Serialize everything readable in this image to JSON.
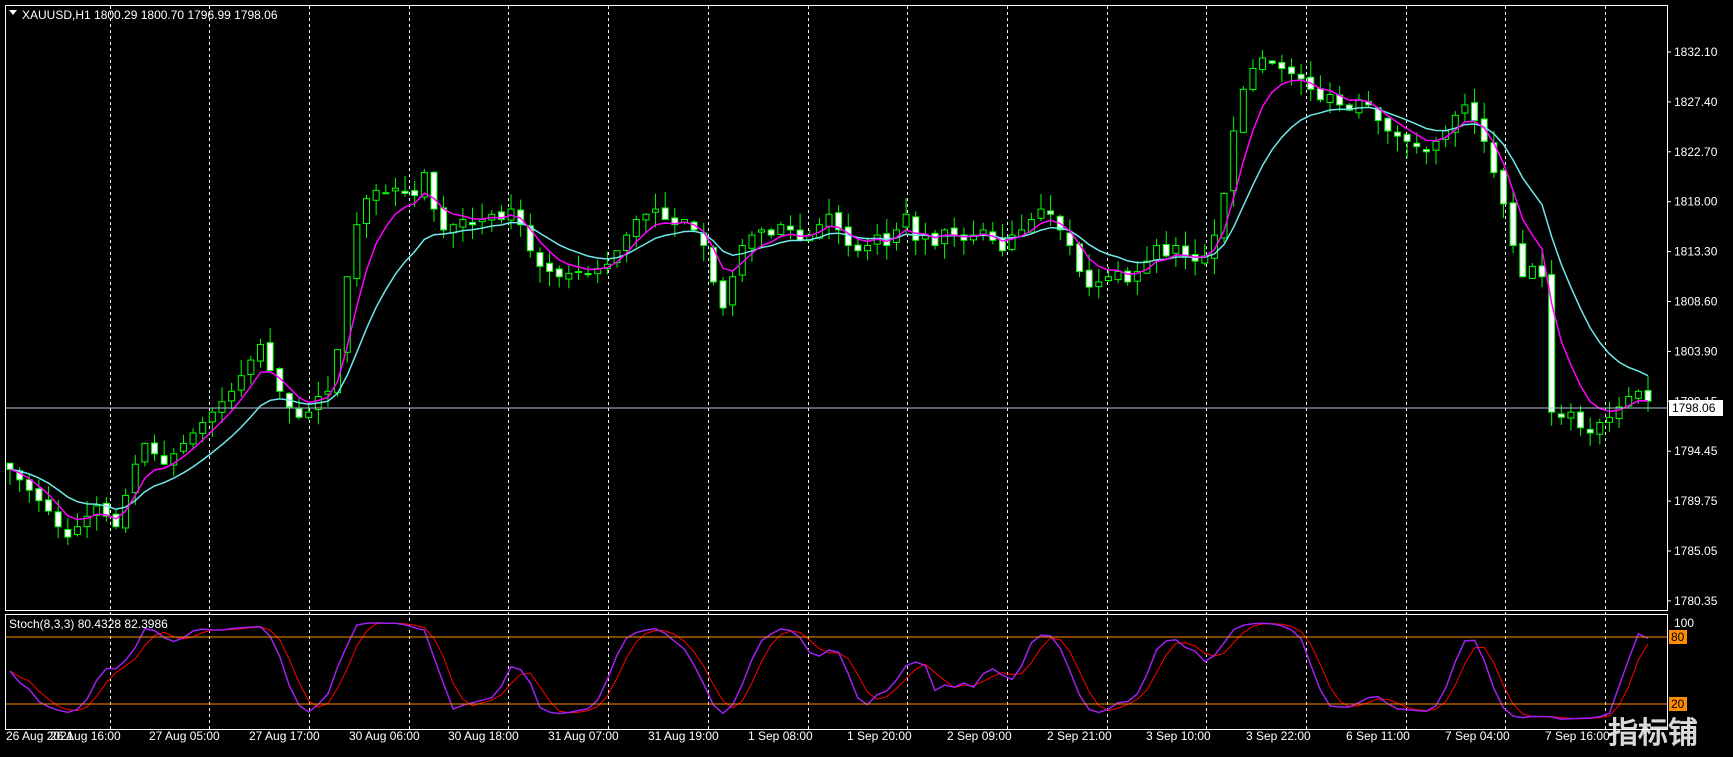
{
  "main_window": {
    "symbol_header": "XAUUSD,H1  1800.29 1800.70 1796.99 1798.06",
    "price_axis_labels": [
      "1832.10",
      "1827.40",
      "1822.70",
      "1818.00",
      "1813.30",
      "1808.60",
      "1803.90",
      "1799.15",
      "1794.45",
      "1789.75",
      "1785.05",
      "1780.35"
    ],
    "current_price_label": "1798.06",
    "colors": {
      "background": "#000000",
      "grid": "#ffffff",
      "bull_candle": "#000000",
      "bear_candle": "#ffffff",
      "wick": "#00ff00",
      "ma_fast": "#ff00ff",
      "ma_slow": "#70e8e8",
      "price_line": "#b0c4de"
    }
  },
  "stoch_window": {
    "header": "Stoch(8,3,3) 80.4328 82.3986",
    "axis_labels": {
      "top": "100",
      "upper_level": "80",
      "lower_level": "20"
    },
    "colors": {
      "main": "#a020f0",
      "signal": "#ff0000",
      "levels": "#ff8c00"
    }
  },
  "time_axis": {
    "labels": [
      "26 Aug 2021",
      "26 Aug 16:00",
      "27 Aug 05:00",
      "27 Aug 17:00",
      "30 Aug 06:00",
      "30 Aug 18:00",
      "31 Aug 07:00",
      "31 Aug 19:00",
      "1 Sep 08:00",
      "1 Sep 20:00",
      "2 Sep 09:00",
      "2 Sep 21:00",
      "3 Sep 10:00",
      "3 Sep 22:00",
      "6 Sep 11:00",
      "7 Sep 04:00",
      "7 Sep 16:00"
    ]
  },
  "watermark": {
    "text": "指标铺"
  },
  "chart_data": [
    {
      "type": "candlestick",
      "title": "XAUUSD,H1",
      "ylim": [
        1778.0,
        1836.0
      ],
      "grid": true,
      "close_path": [
        1791.5,
        1790.5,
        1789.5,
        1788.5,
        1787.5,
        1786.0,
        1785.0,
        1786.0,
        1787.0,
        1788.0,
        1787.0,
        1786.0,
        1789.0,
        1792.0,
        1794.0,
        1793.0,
        1792.0,
        1793.0,
        1794.0,
        1795.0,
        1796.0,
        1797.0,
        1798.0,
        1799.0,
        1800.5,
        1802.0,
        1803.5,
        1801.0,
        1799.0,
        1797.5,
        1796.5,
        1797.0,
        1798.5,
        1799.0,
        1803.0,
        1810.0,
        1815.0,
        1817.5,
        1818.3,
        1818.0,
        1818.5,
        1818.0,
        1817.8,
        1820.0,
        1816.5,
        1814.5,
        1815.0,
        1815.5,
        1815.0,
        1815.5,
        1816.0,
        1815.5,
        1816.5,
        1815.0,
        1812.5,
        1811.0,
        1810.5,
        1810.0,
        1810.3,
        1810.5,
        1810.2,
        1810.8,
        1811.2,
        1812.5,
        1814.0,
        1815.5,
        1816.0,
        1816.5,
        1815.5,
        1815.0,
        1815.5,
        1814.5,
        1813.0,
        1809.5,
        1807.0,
        1810.0,
        1813.0,
        1814.0,
        1814.5,
        1814.0,
        1815.0,
        1814.5,
        1813.5,
        1814.0,
        1815.0,
        1816.0,
        1814.5,
        1813.0,
        1812.5,
        1813.0,
        1814.0,
        1813.0,
        1814.5,
        1816.0,
        1813.5,
        1814.0,
        1813.0,
        1814.5,
        1814.0,
        1813.5,
        1814.0,
        1814.5,
        1813.5,
        1812.5,
        1814.0,
        1814.5,
        1815.5,
        1816.5,
        1816.0,
        1814.5,
        1813.0,
        1810.5,
        1809.0,
        1809.5,
        1810.0,
        1810.5,
        1809.5,
        1810.5,
        1811.5,
        1813.0,
        1812.0,
        1813.0,
        1812.0,
        1811.5,
        1812.0,
        1814.0,
        1818.0,
        1824.0,
        1828.0,
        1830.0,
        1831.0,
        1830.5,
        1830.0,
        1829.5,
        1829.0,
        1828.0,
        1827.0,
        1827.5,
        1826.5,
        1826.0,
        1827.0,
        1826.5,
        1825.0,
        1824.0,
        1823.5,
        1823.0,
        1822.5,
        1822.0,
        1823.0,
        1824.0,
        1825.5,
        1826.5,
        1825.0,
        1823.0,
        1820.0,
        1817.0,
        1813.0,
        1810.0,
        1811.0,
        1810.0,
        1797.0,
        1796.5,
        1797.0,
        1795.5,
        1795.0,
        1796.0,
        1796.5,
        1797.5,
        1798.5,
        1799.0,
        1798.06
      ],
      "ma_fast_end": 1798.1,
      "ma_slow_end": 1800.3,
      "current_price": 1798.06
    },
    {
      "type": "line",
      "title": "Stoch(8,3,3)",
      "ylim": [
        0,
        100
      ],
      "levels": [
        20,
        80
      ],
      "series": [
        {
          "name": "Main",
          "last": 80.4328
        },
        {
          "name": "Signal",
          "last": 82.3986
        }
      ]
    }
  ]
}
